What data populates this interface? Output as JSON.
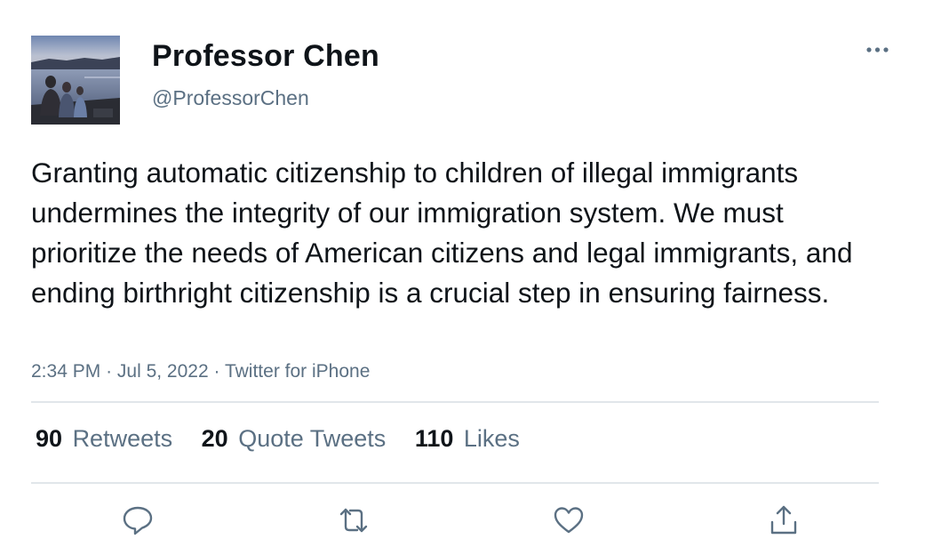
{
  "user": {
    "display_name": "Professor Chen",
    "handle": "@ProfessorChen",
    "avatar": "avatar-photo-lake-family"
  },
  "tweet": {
    "text": "Granting automatic citizenship to children of illegal immigrants undermines the integrity of our immigration system. We must prioritize the needs of American citizens and legal immigrants, and ending birthright citizenship is a crucial step in ensuring fairness.",
    "time": "2:34 PM",
    "date": "Jul 5, 2022",
    "source": "Twitter for iPhone",
    "separator": "·"
  },
  "stats": {
    "retweets_count": "90",
    "retweets_label": "Retweets",
    "quotes_count": "20",
    "quotes_label": "Quote Tweets",
    "likes_count": "110",
    "likes_label": "Likes"
  },
  "icons": {
    "more": "more-dots-icon",
    "reply": "reply-icon",
    "retweet": "retweet-icon",
    "like": "heart-icon",
    "share": "share-icon"
  },
  "colors": {
    "text_primary": "#0f1419",
    "text_secondary": "#5b7083",
    "divider": "#e1e6ea"
  }
}
